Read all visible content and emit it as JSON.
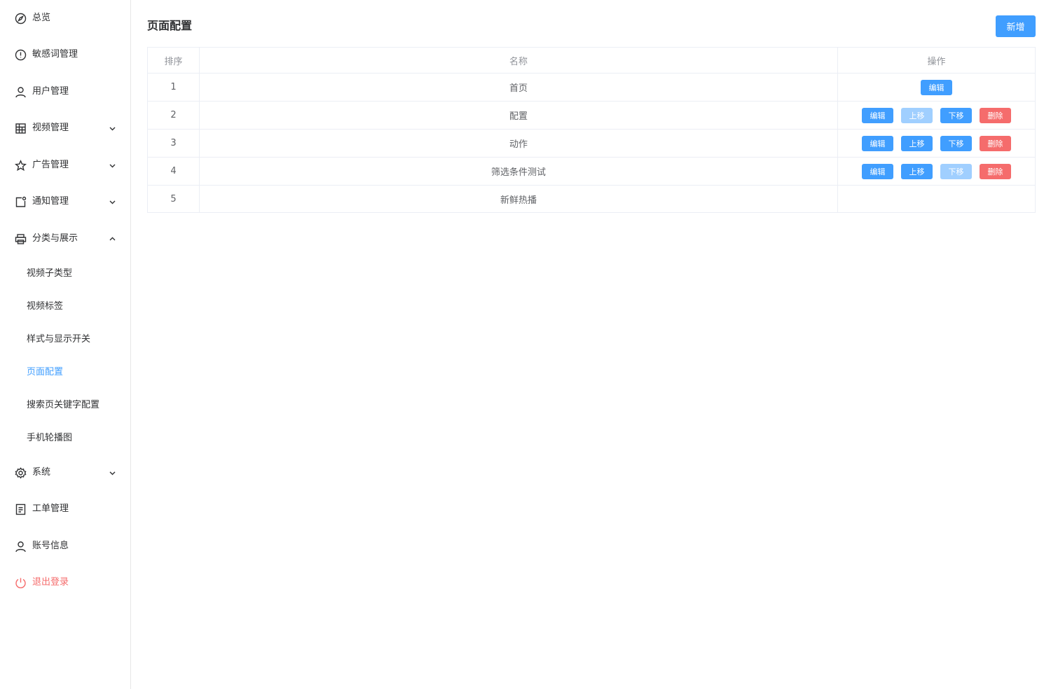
{
  "sidebar": {
    "items": [
      {
        "label": "总览"
      },
      {
        "label": "敏感词管理"
      },
      {
        "label": "用户管理"
      },
      {
        "label": "视频管理"
      },
      {
        "label": "广告管理"
      },
      {
        "label": "通知管理"
      },
      {
        "label": "分类与展示"
      },
      {
        "label": "系统"
      },
      {
        "label": "工单管理"
      },
      {
        "label": "账号信息"
      },
      {
        "label": "退出登录"
      }
    ],
    "sub_items": [
      {
        "label": "视频子类型"
      },
      {
        "label": "视频标签"
      },
      {
        "label": "样式与显示开关"
      },
      {
        "label": "页面配置",
        "active": true
      },
      {
        "label": "搜索页关键字配置"
      },
      {
        "label": "手机轮播图"
      }
    ]
  },
  "header": {
    "title": "页面配置",
    "add_label": "新增"
  },
  "table": {
    "columns": [
      "排序",
      "名称",
      "操作"
    ],
    "rows": [
      {
        "order": "1",
        "name": "首页"
      },
      {
        "order": "2",
        "name": "配置"
      },
      {
        "order": "3",
        "name": "动作"
      },
      {
        "order": "4",
        "name": "筛选条件测试"
      },
      {
        "order": "5",
        "name": "新鲜热播"
      }
    ],
    "actions": {
      "edit": "编辑",
      "up": "上移",
      "down": "下移",
      "delete": "删除"
    }
  },
  "colors": {
    "primary": "#409eff",
    "primary_disabled": "#a0cfff",
    "danger": "#f56c6c",
    "active_text": "#409eff"
  }
}
